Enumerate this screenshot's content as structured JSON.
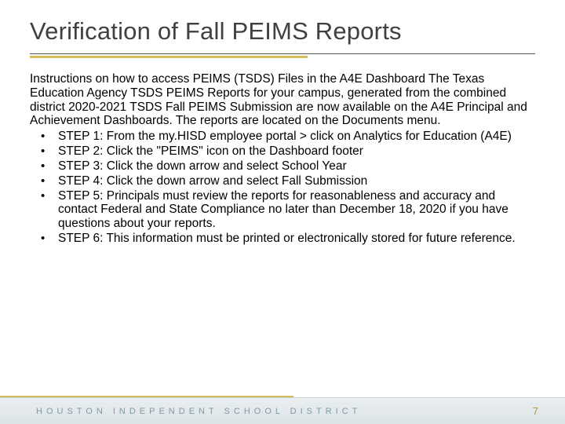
{
  "title": "Verification of Fall PEIMS Reports",
  "intro": "Instructions on how to access PEIMS (TSDS) Files in the A4E Dashboard The Texas Education Agency TSDS PEIMS Reports for your campus, generated from the combined district 2020-2021 TSDS Fall PEIMS Submission are now available on the A4E Principal and Achievement Dashboards. The reports are located on the Documents menu.",
  "steps": [
    "STEP 1: From the my.HISD employee portal > click on Analytics for Education (A4E)",
    "STEP 2: Click the \"PEIMS\" icon on the Dashboard footer",
    "STEP 3: Click the down arrow and select School Year",
    "STEP 4: Click the down arrow and select Fall Submission",
    "STEP 5: Principals must review the reports for reasonableness and accuracy and contact Federal and State Compliance no later than December 18, 2020 if you have questions about your reports.",
    "STEP 6: This information must be printed or electronically stored for future reference."
  ],
  "footer": {
    "branding": "HOUSTON INDEPENDENT SCHOOL DISTRICT",
    "page": "7"
  }
}
